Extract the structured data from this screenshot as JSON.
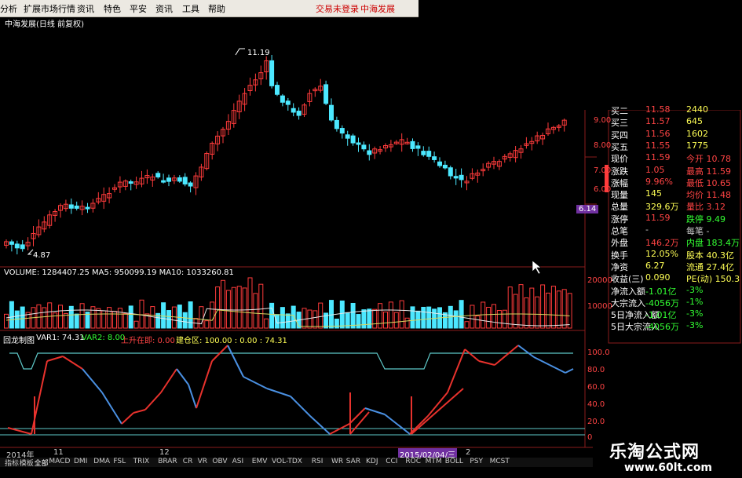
{
  "menu": {
    "items": [
      "分析",
      "扩展市场行情",
      "资讯",
      "特色",
      "平安",
      "资讯",
      "工具",
      "帮助"
    ],
    "alerts": [
      "交易未登录",
      "中海发展"
    ]
  },
  "title": "中海发展(日线 前复权)",
  "price_labels": {
    "high": "11.19",
    "low": "4.87",
    "last": "6.14"
  },
  "volume_header": "VOLUME: 1284407.25  MA5: 950099.19  MA10: 1033260.81",
  "indicator_header": {
    "name": "回龙制图",
    "var1": "VAR1: 74.31",
    "var2": "VAR2: 8.00",
    "up": "上升在即: 0.00",
    "build": "建仓区: 100.00 : 0.00 : 74.31"
  },
  "y_axis": {
    "price": [
      "9.00",
      "8.00",
      "7.00",
      "6.00"
    ],
    "volume": [
      "20000",
      "10000"
    ],
    "indicator": [
      "100.0",
      "80.0",
      "60.0",
      "40.0",
      "20.0",
      "0.0"
    ]
  },
  "dates": {
    "start": "2014年",
    "m1": "11",
    "m2": "12",
    "highlight": "2015/02/04/三",
    "m3": "2"
  },
  "quote_rows": [
    {
      "a": "买二",
      "b": "11.58",
      "c": "2440",
      "ac": "#fff",
      "bc": "#ff4444",
      "cc": "#ffff55"
    },
    {
      "a": "买三",
      "b": "11.57",
      "c": "645",
      "ac": "#fff",
      "bc": "#ff4444",
      "cc": "#ffff55"
    },
    {
      "a": "买四",
      "b": "11.56",
      "c": "1602",
      "ac": "#fff",
      "bc": "#ff4444",
      "cc": "#ffff55"
    },
    {
      "a": "买五",
      "b": "11.55",
      "c": "1775",
      "ac": "#fff",
      "bc": "#ff4444",
      "cc": "#ffff55"
    },
    {
      "a": "现价",
      "b": "11.59",
      "c": "今开  10.78",
      "ac": "#fff",
      "bc": "#ff4444",
      "cc": "#ff4444"
    },
    {
      "a": "涨跌",
      "b": "1.05",
      "c": "最高  11.59",
      "ac": "#fff",
      "bc": "#ff4444",
      "cc": "#ff4444"
    },
    {
      "a": "涨幅",
      "b": "9.96%",
      "c": "最低  10.65",
      "ac": "#fff",
      "bc": "#ff4444",
      "cc": "#ff4444"
    },
    {
      "a": "现量",
      "b": "145",
      "c": "均价  11.48",
      "ac": "#fff",
      "bc": "#ffff55",
      "cc": "#ff4444"
    },
    {
      "a": "总量",
      "b": "329.6万",
      "c": "量比  3.12",
      "ac": "#fff",
      "bc": "#ffff55",
      "cc": "#ff4444"
    },
    {
      "a": "涨停",
      "b": "11.59",
      "c": "跌停  9.49",
      "ac": "#fff",
      "bc": "#ff4444",
      "cc": "#33ff33"
    },
    {
      "a": "总笔",
      "b": "-",
      "c": "每笔  -",
      "ac": "#fff",
      "bc": "#ccc",
      "cc": "#ccc"
    },
    {
      "a": "外盘",
      "b": "146.2万",
      "c": "内盘  183.4万",
      "ac": "#fff",
      "bc": "#ff4444",
      "cc": "#33ff33"
    },
    {
      "a": "换手",
      "b": "12.05%",
      "c": "股本  40.3亿",
      "ac": "#fff",
      "bc": "#ffff55",
      "cc": "#ffff55"
    },
    {
      "a": "净资",
      "b": "6.27",
      "c": "流通  27.4亿",
      "ac": "#fff",
      "bc": "#ffff55",
      "cc": "#ffff55"
    },
    {
      "a": "收益(三)",
      "b": "0.090",
      "c": "PE(动)  150.3",
      "ac": "#fff",
      "bc": "#ffff55",
      "cc": "#ffff55"
    },
    {
      "a": "净流入额",
      "b": "-1.01亿",
      "c": "-3%",
      "ac": "#fff",
      "bc": "#33ff33",
      "cc": "#33ff33"
    },
    {
      "a": "大宗流入",
      "b": "-4056万",
      "c": "-1%",
      "ac": "#fff",
      "bc": "#33ff33",
      "cc": "#33ff33"
    },
    {
      "a": "5日净流入额",
      "b": "-1.01亿",
      "c": "-3%",
      "ac": "#fff",
      "bc": "#33ff33",
      "cc": "#33ff33"
    },
    {
      "a": "5日大宗流入",
      "b": "-4056万",
      "c": "-3%",
      "ac": "#fff",
      "bc": "#33ff33",
      "cc": "#33ff33"
    }
  ],
  "tabs": [
    "指标",
    "模板",
    "全部",
    "MACD",
    "DMI",
    "DMA",
    "FSL",
    "TRIX",
    "BRAR",
    "CR",
    "VR",
    "OBV",
    "ASI",
    "EMV",
    "VOL-TDX",
    "RSI",
    "WR",
    "SAR",
    "KDJ",
    "CCI",
    "ROC",
    "MTM",
    "BOLL",
    "PSY",
    "MCST"
  ],
  "watermark": {
    "text": "乐淘公式网",
    "url": "www.60lt.com"
  },
  "colors": {
    "up": "#ff3b3b",
    "down": "#4ce8ff",
    "grid": "#8a1c1c",
    "ma_white": "#e8e8e8",
    "ma_yellow": "#d8d860",
    "line_cyan": "#5ec8c8"
  }
}
